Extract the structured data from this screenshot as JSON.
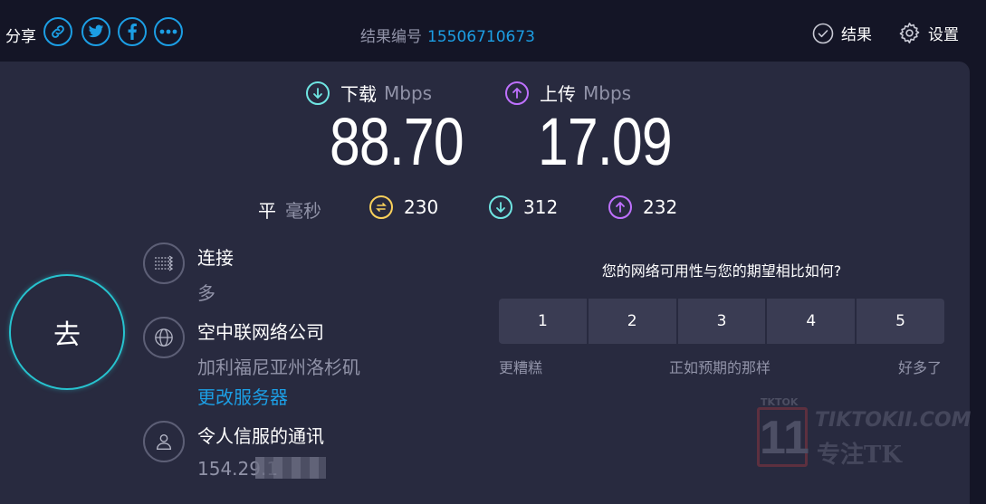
{
  "header": {
    "share_label": "分享",
    "result_label": "结果编号",
    "result_id": "15506710673",
    "results_label": "结果",
    "settings_label": "设置"
  },
  "icons": {
    "share": [
      "link-icon",
      "twitter-icon",
      "facebook-icon",
      "more-icon"
    ],
    "download": "arrow-down-circle-icon",
    "upload": "arrow-up-circle-icon",
    "ping": "ping-icon",
    "connections": "connections-icon",
    "server": "globe-icon",
    "provider": "user-icon"
  },
  "speed": {
    "download_label": "下载",
    "upload_label": "上传",
    "unit": "Mbps",
    "download_value": "88.70",
    "upload_value": "17.09"
  },
  "ping": {
    "label": "平",
    "unit": "毫秒",
    "idle": "230",
    "download": "312",
    "upload": "232"
  },
  "go_label": "去",
  "connection": {
    "title": "连接",
    "value": "多"
  },
  "server": {
    "name": "空中联网络公司",
    "location": "加利福尼亚州洛杉矶",
    "change_link": "更改服务器"
  },
  "provider": {
    "name": "令人信服的通讯",
    "ip": "154.29.1"
  },
  "survey": {
    "question": "您的网络可用性与您的期望相比如何?",
    "options": [
      "1",
      "2",
      "3",
      "4",
      "5"
    ],
    "low_label": "更糟糕",
    "mid_label": "正如预期的那样",
    "high_label": "好多了"
  },
  "watermark": {
    "tag": "TKTOK",
    "logo": "11",
    "brand": "TIKTOKII.COM",
    "brand_cn": "专注TK"
  },
  "colors": {
    "accent_blue": "#1c9ee4",
    "download_cyan": "#6fe5e2",
    "upload_purple": "#bf71ff",
    "ping_yellow": "#fbd15b",
    "go_ring": "#27c3cf",
    "background": "#141526",
    "panel": "#282a3f"
  }
}
